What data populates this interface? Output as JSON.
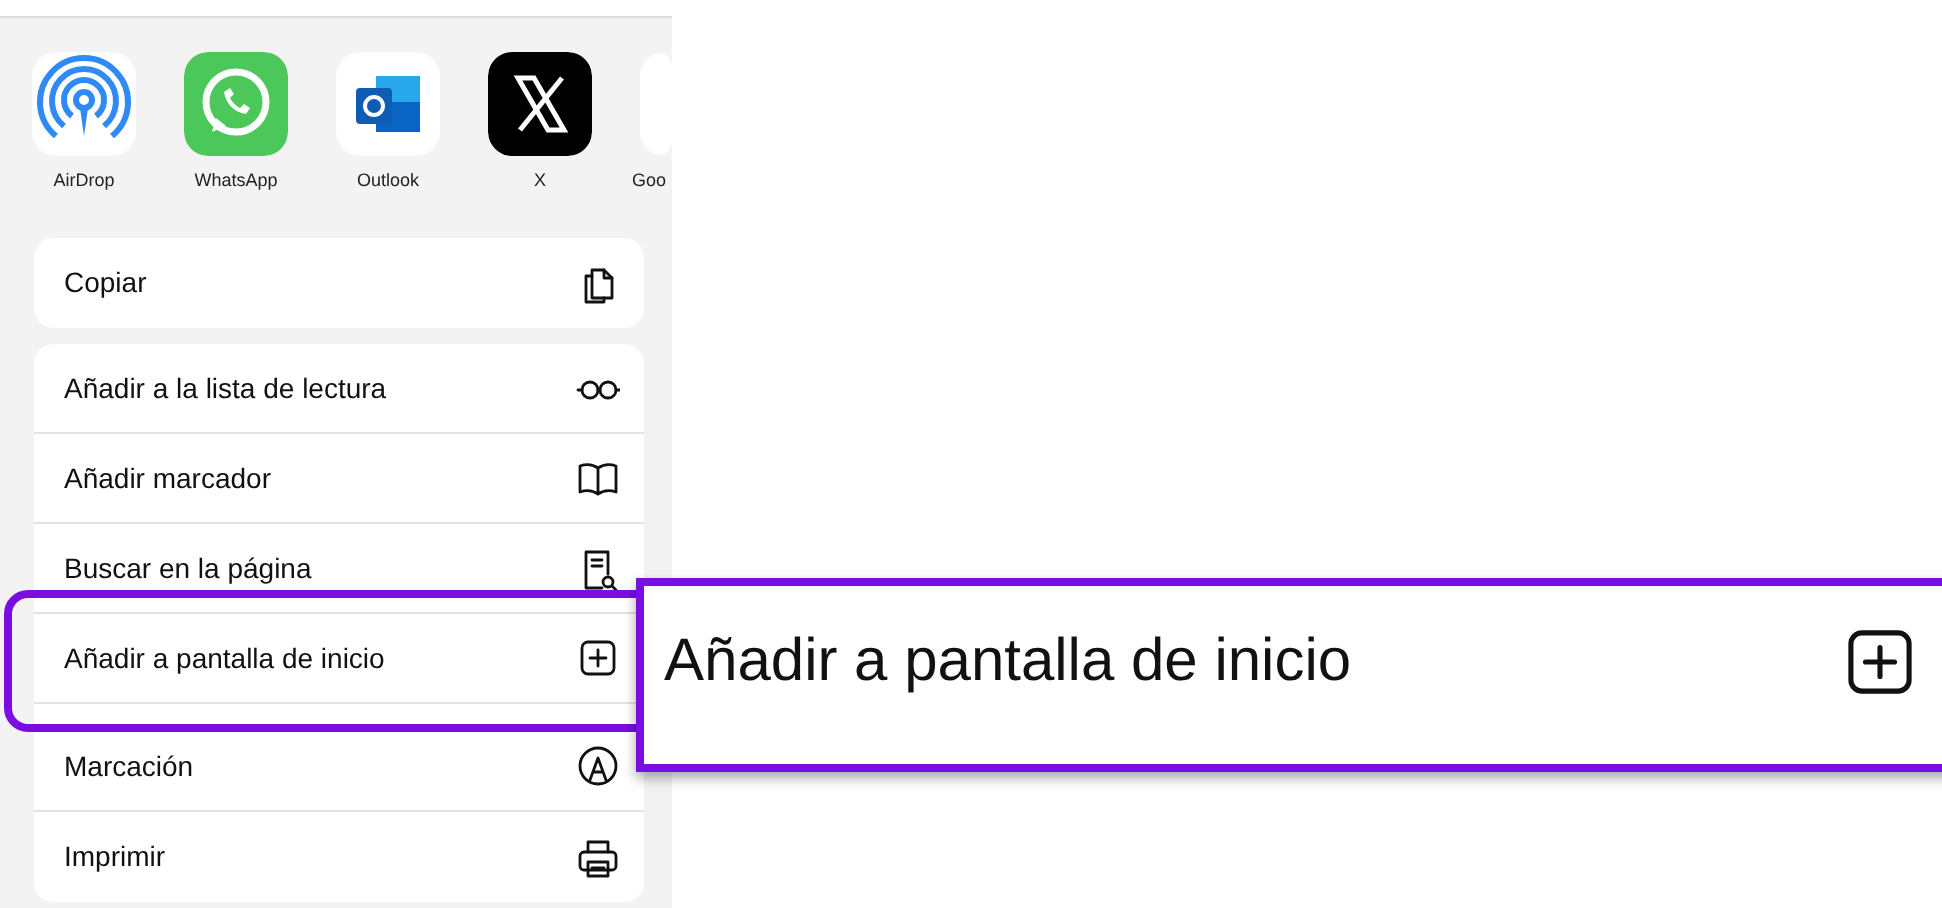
{
  "apps": [
    {
      "kind": "airdrop",
      "label": "AirDrop"
    },
    {
      "kind": "whatsapp",
      "label": "WhatsApp"
    },
    {
      "kind": "outlook",
      "label": "Outlook"
    },
    {
      "kind": "x",
      "label": "X"
    },
    {
      "kind": "blank",
      "label": "Goo"
    }
  ],
  "action_groups": [
    [
      {
        "label": "Copiar",
        "kind": "copy",
        "highlighted": false
      }
    ],
    [
      {
        "label": "Añadir a la lista de lectura",
        "kind": "reading-list",
        "highlighted": false
      },
      {
        "label": "Añadir marcador",
        "kind": "bookmark",
        "highlighted": false
      },
      {
        "label": "Buscar en la página",
        "kind": "find",
        "highlighted": false
      },
      {
        "label": "Añadir a pantalla de inicio",
        "kind": "home-screen",
        "highlighted": true
      },
      {
        "label": "Marcación",
        "kind": "markup",
        "highlighted": false
      },
      {
        "label": "Imprimir",
        "kind": "print",
        "highlighted": false
      }
    ]
  ],
  "callout": {
    "label": "Añadir a pantalla de inicio",
    "kind": "home-screen"
  }
}
